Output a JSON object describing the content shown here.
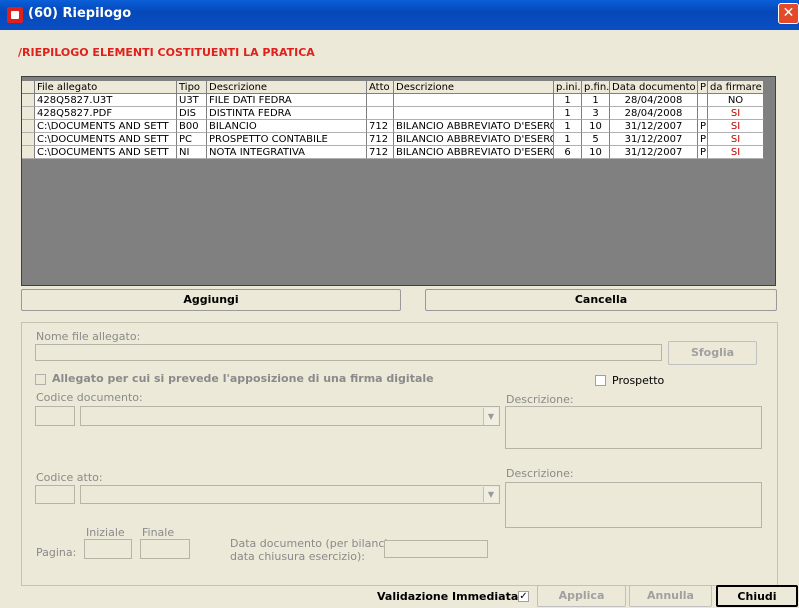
{
  "window": {
    "title": "(60) Riepilogo",
    "close_glyph": "✕"
  },
  "section_title": "/RIEPILOGO ELEMENTI COSTITUENTI LA PRATICA",
  "table": {
    "headers": [
      "File allegato",
      "Tipo",
      "Descrizione",
      "Atto",
      "Descrizione",
      "p.ini.",
      "p.fin.",
      "Data documento",
      "P",
      "da firmare"
    ],
    "rows": [
      [
        "428Q5827.U3T",
        "U3T",
        "FILE DATI FEDRA",
        "",
        "",
        "1",
        "1",
        "28/04/2008",
        "",
        "NO"
      ],
      [
        "428Q5827.PDF",
        "DIS",
        "DISTINTA FEDRA",
        "",
        "",
        "1",
        "3",
        "28/04/2008",
        "",
        "SI"
      ],
      [
        "C:\\DOCUMENTS AND SETT",
        "B00",
        "BILANCIO",
        "712",
        "BILANCIO ABBREVIATO D'ESERC",
        "1",
        "10",
        "31/12/2007",
        "P",
        "SI"
      ],
      [
        "C:\\DOCUMENTS AND SETT",
        "PC",
        "PROSPETTO CONTABILE",
        "712",
        "BILANCIO ABBREVIATO D'ESERC",
        "1",
        "5",
        "31/12/2007",
        "P",
        "SI"
      ],
      [
        "C:\\DOCUMENTS AND SETT",
        "NI",
        "NOTA INTEGRATIVA",
        "712",
        "BILANCIO ABBREVIATO D'ESERC",
        "6",
        "10",
        "31/12/2007",
        "P",
        "SI"
      ]
    ]
  },
  "buttons": {
    "aggiungi": "Aggiungi",
    "cancella": "Cancella",
    "sfoglia": "Sfoglia",
    "applica": "Applica",
    "annulla": "Annulla",
    "chiudi": "Chiudi"
  },
  "form": {
    "nome_file_label": "Nome file allegato:",
    "firma_label": "Allegato per cui si prevede l'apposizione di una firma digitale",
    "prospetto_label": "Prospetto",
    "codice_documento_label": "Codice documento:",
    "descrizione_label": "Descrizione:",
    "codice_atto_label": "Codice atto:",
    "descrizione2_label": "Descrizione:",
    "iniziale_label": "Iniziale",
    "finale_label": "Finale",
    "pagina_label": "Pagina:",
    "data_doc_label_1": "Data documento (per bilancio",
    "data_doc_label_2": "data chiusura esercizio):"
  },
  "footer": {
    "validazione_label": "Validazione Immediata",
    "validazione_checked": true,
    "check_glyph": "✓"
  },
  "colors": {
    "title_bar": "#0548b8",
    "accent_red": "#e0201c",
    "grid_bg": "#808080"
  },
  "icons": {
    "app": "app-icon",
    "close": "close-icon",
    "dropdown": "chevron-down-icon"
  }
}
